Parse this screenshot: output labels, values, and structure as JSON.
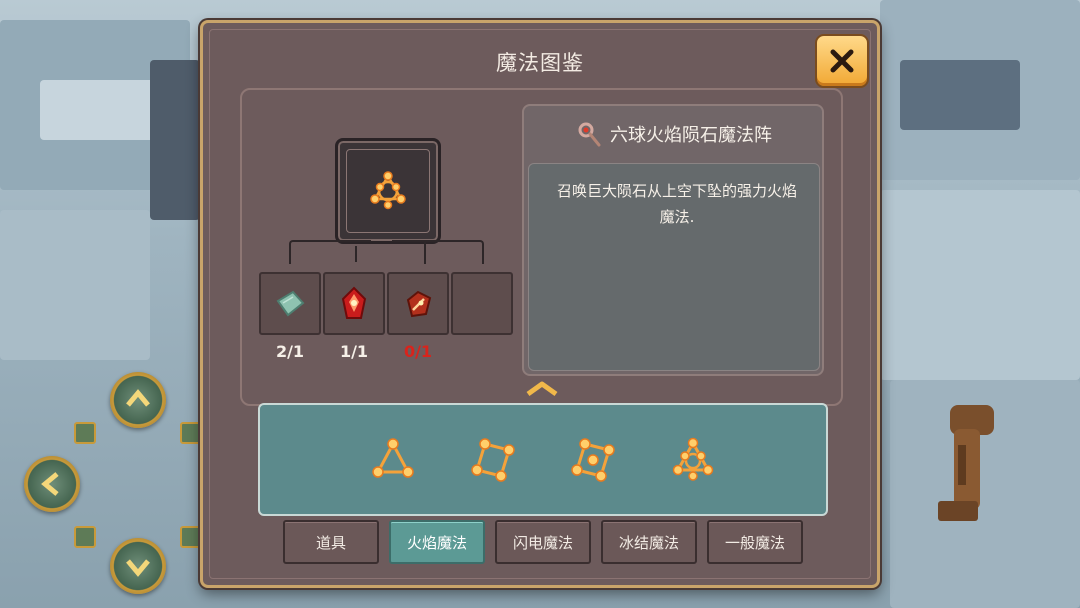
{
  "panel": {
    "title": "魔法图鉴",
    "close_icon": "close-x-icon"
  },
  "selected_spell": {
    "name": "六球火焰陨石魔法阵",
    "icon": "staff-icon",
    "description": "召唤巨大陨石从上空下坠的强力火焰魔法."
  },
  "recipe": {
    "result_icon": "fire-triangle-circle-icon",
    "ingredients": [
      {
        "icon": "stone-slab-icon",
        "count": "2/1",
        "sufficient": true
      },
      {
        "icon": "fire-crystal-icon",
        "count": "1/1",
        "sufficient": true
      },
      {
        "icon": "fire-gem-icon",
        "count": "0/1",
        "sufficient": false
      },
      {
        "icon": "empty-slot",
        "count": "",
        "sufficient": true
      }
    ]
  },
  "spells": [
    {
      "icon": "fire-triangle-icon"
    },
    {
      "icon": "fire-square-icon"
    },
    {
      "icon": "fire-square-center-icon"
    },
    {
      "icon": "fire-triangle-circle-icon"
    }
  ],
  "tabs": [
    {
      "label": "道具",
      "active": false
    },
    {
      "label": "火焰魔法",
      "active": true
    },
    {
      "label": "闪电魔法",
      "active": false
    },
    {
      "label": "冰结魔法",
      "active": false
    },
    {
      "label": "一般魔法",
      "active": false
    }
  ],
  "colors": {
    "panel_bg": "#6d5b5c",
    "gold_border": "#c9a46a",
    "active_tab": "#5c9a95",
    "spell_list_bg": "#5c8a8c",
    "shortage_red": "#d8241c",
    "fire_orange": "#f4a23a"
  }
}
